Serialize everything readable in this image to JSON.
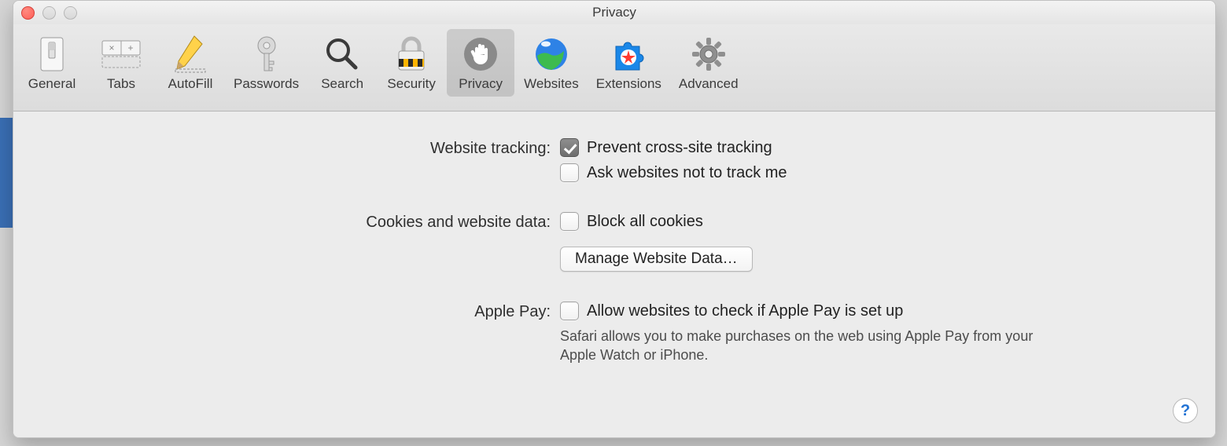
{
  "window": {
    "title": "Privacy"
  },
  "toolbar": {
    "items": [
      {
        "id": "general",
        "label": "General"
      },
      {
        "id": "tabs",
        "label": "Tabs"
      },
      {
        "id": "autofill",
        "label": "AutoFill"
      },
      {
        "id": "passwords",
        "label": "Passwords"
      },
      {
        "id": "search",
        "label": "Search"
      },
      {
        "id": "security",
        "label": "Security"
      },
      {
        "id": "privacy",
        "label": "Privacy",
        "selected": true
      },
      {
        "id": "websites",
        "label": "Websites"
      },
      {
        "id": "extensions",
        "label": "Extensions"
      },
      {
        "id": "advanced",
        "label": "Advanced"
      }
    ]
  },
  "sections": {
    "tracking": {
      "label": "Website tracking:",
      "prevent_cross_site": {
        "label": "Prevent cross-site tracking",
        "checked": true
      },
      "do_not_track": {
        "label": "Ask websites not to track me",
        "checked": false
      }
    },
    "cookies": {
      "label": "Cookies and website data:",
      "block_all": {
        "label": "Block all cookies",
        "checked": false
      },
      "manage_button": "Manage Website Data…"
    },
    "applepay": {
      "label": "Apple Pay:",
      "allow_check": {
        "label": "Allow websites to check if Apple Pay is set up",
        "checked": false
      },
      "help": "Safari allows you to make purchases on the web using Apple Pay from your Apple Watch or iPhone."
    }
  },
  "help_icon": "?"
}
